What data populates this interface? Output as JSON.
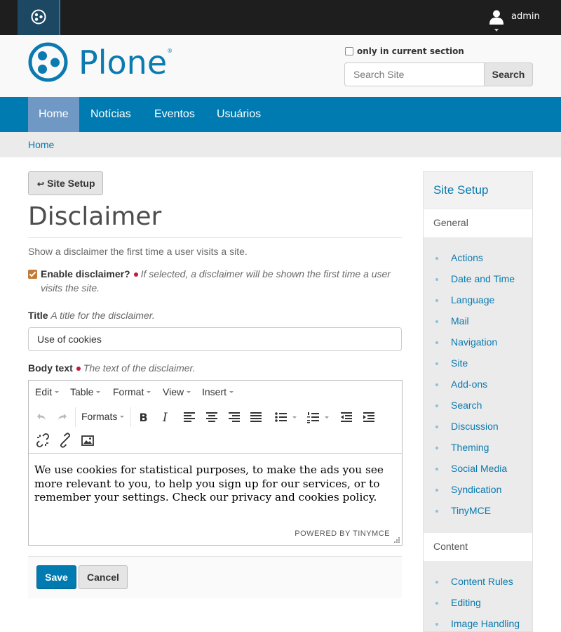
{
  "toolbar": {
    "username": "admin"
  },
  "header": {
    "logo_text": "Plone",
    "logo_mark": "®",
    "search_option": "only in current section",
    "search_placeholder": "Search Site",
    "search_button": "Search"
  },
  "nav": {
    "items": [
      "Home",
      "Notícias",
      "Eventos",
      "Usuários"
    ]
  },
  "breadcrumb": {
    "home": "Home"
  },
  "main": {
    "setup_button": "Site Setup",
    "setup_arrow": "↩",
    "title": "Disclaimer",
    "description": "Show a disclaimer the first time a user visits a site.",
    "enable_label": "Enable disclaimer?",
    "enable_help": "If selected, a disclaimer will be shown the first time a user visits the site.",
    "enable_checked": true,
    "title_label": "Title",
    "title_help": "A title for the disclaimer.",
    "title_value": "Use of cookies",
    "body_label": "Body text",
    "body_help": "The text of the disclaimer.",
    "editor": {
      "menus": [
        "Edit",
        "Table",
        "Format",
        "View",
        "Insert"
      ],
      "formats_label": "Formats",
      "content": "We use cookies for statistical purposes, to make the ads you see more relevant to you, to help you sign up for our services, or to remember your settings. Check our privacy and cookies policy.",
      "powered_by": "POWERED BY TINYMCE"
    },
    "save_button": "Save",
    "cancel_button": "Cancel"
  },
  "sidebar": {
    "title": "Site Setup",
    "sections": [
      {
        "heading": "General",
        "items": [
          "Actions",
          "Date and Time",
          "Language",
          "Mail",
          "Navigation",
          "Site",
          "Add-ons",
          "Search",
          "Discussion",
          "Theming",
          "Social Media",
          "Syndication",
          "TinyMCE"
        ]
      },
      {
        "heading": "Content",
        "items": [
          "Content Rules",
          "Editing",
          "Image Handling"
        ]
      }
    ]
  },
  "colors": {
    "brand_blue": "#007bb1",
    "nav_active": "#6f99c4",
    "toolbar_bg": "#1e1e1e",
    "checkbox_orange": "#c27a35",
    "required_red": "#c4183c"
  }
}
